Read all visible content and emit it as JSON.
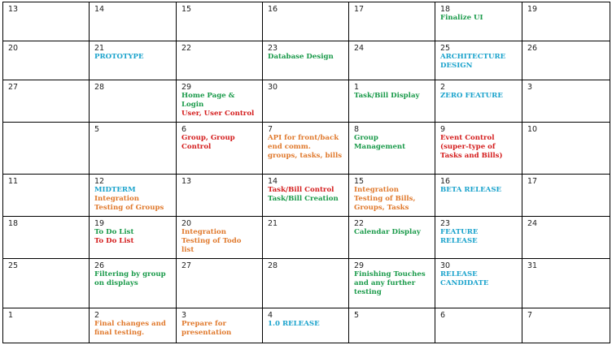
{
  "rows": [
    [
      {
        "day": "13",
        "events": []
      },
      {
        "day": "14",
        "events": []
      },
      {
        "day": "15",
        "events": []
      },
      {
        "day": "16",
        "events": []
      },
      {
        "day": "17",
        "events": []
      },
      {
        "day": "18",
        "events": [
          {
            "text": "Finalize UI",
            "color": "green"
          }
        ]
      },
      {
        "day": "19",
        "events": []
      }
    ],
    [
      {
        "day": "20",
        "events": []
      },
      {
        "day": "21",
        "events": [
          {
            "text": "PROTOTYPE",
            "color": "blue"
          }
        ]
      },
      {
        "day": "22",
        "events": []
      },
      {
        "day": "23",
        "events": [
          {
            "text": "Database Design",
            "color": "green"
          }
        ]
      },
      {
        "day": "24",
        "events": []
      },
      {
        "day": "25",
        "events": [
          {
            "text": "ARCHITECTURE\nDESIGN",
            "color": "blue"
          }
        ]
      },
      {
        "day": "26",
        "events": []
      }
    ],
    [
      {
        "day": "27",
        "events": []
      },
      {
        "day": "28",
        "events": []
      },
      {
        "day": "29",
        "events": [
          {
            "text": "Home Page &\nLogin",
            "color": "green"
          },
          {
            "text": "User, User Control",
            "color": "red"
          }
        ]
      },
      {
        "day": "30",
        "events": []
      },
      {
        "day": "1",
        "events": [
          {
            "text": "Task/Bill Display",
            "color": "green"
          }
        ]
      },
      {
        "day": "2",
        "events": [
          {
            "text": "ZERO FEATURE",
            "color": "blue"
          }
        ]
      },
      {
        "day": "3",
        "events": []
      }
    ],
    [
      {
        "day": "",
        "events": []
      },
      {
        "day": "5",
        "events": []
      },
      {
        "day": "6",
        "events": [
          {
            "text": "Group, Group\nControl",
            "color": "red"
          }
        ]
      },
      {
        "day": "7",
        "events": [
          {
            "text": "API for front/back\nend comm.\ngroups, tasks, bills",
            "color": "orange"
          }
        ]
      },
      {
        "day": "8",
        "events": [
          {
            "text": "Group\nManagement",
            "color": "green"
          }
        ]
      },
      {
        "day": "9",
        "events": [
          {
            "text": "Event Control\n(super-type of\nTasks and Bills)",
            "color": "red"
          }
        ]
      },
      {
        "day": "10",
        "events": []
      }
    ],
    [
      {
        "day": "11",
        "events": []
      },
      {
        "day": "12",
        "events": [
          {
            "text": "MIDTERM",
            "color": "blue"
          },
          {
            "text": "Integration\nTesting of Groups",
            "color": "orange"
          }
        ]
      },
      {
        "day": "13",
        "events": []
      },
      {
        "day": "14",
        "events": [
          {
            "text": "Task/Bill Control",
            "color": "red"
          },
          {
            "text": "Task/Bill Creation",
            "color": "green"
          }
        ]
      },
      {
        "day": "15",
        "events": [
          {
            "text": "Integration\nTesting of Bills,\nGroups, Tasks",
            "color": "orange"
          }
        ]
      },
      {
        "day": "16",
        "events": [
          {
            "text": "BETA RELEASE",
            "color": "blue"
          }
        ]
      },
      {
        "day": "17",
        "events": []
      }
    ],
    [
      {
        "day": "18",
        "events": []
      },
      {
        "day": "19",
        "events": [
          {
            "text": "To Do List",
            "color": "green"
          },
          {
            "text": "To Do List",
            "color": "red"
          }
        ]
      },
      {
        "day": "20",
        "events": [
          {
            "text": "Integration\nTesting of Todo\nlist",
            "color": "orange"
          }
        ]
      },
      {
        "day": "21",
        "events": []
      },
      {
        "day": "22",
        "events": [
          {
            "text": "Calendar Display",
            "color": "green"
          }
        ]
      },
      {
        "day": "23",
        "events": [
          {
            "text": "FEATURE\nRELEASE",
            "color": "blue"
          }
        ]
      },
      {
        "day": "24",
        "events": []
      }
    ],
    [
      {
        "day": "25",
        "events": []
      },
      {
        "day": "26",
        "events": [
          {
            "text": "Filtering by group\non displays",
            "color": "green"
          }
        ]
      },
      {
        "day": "27",
        "events": []
      },
      {
        "day": "28",
        "events": []
      },
      {
        "day": "29",
        "events": [
          {
            "text": "Finishing Touches\nand any further\ntesting",
            "color": "green"
          }
        ]
      },
      {
        "day": "30",
        "events": [
          {
            "text": "RELEASE\nCANDIDATE",
            "color": "blue"
          }
        ]
      },
      {
        "day": "31",
        "events": []
      }
    ],
    [
      {
        "day": "1",
        "events": []
      },
      {
        "day": "2",
        "events": [
          {
            "text": "Final changes and\nfinal testing.",
            "color": "orange"
          }
        ]
      },
      {
        "day": "3",
        "events": [
          {
            "text": "Prepare for\npresentation",
            "color": "orange"
          }
        ]
      },
      {
        "day": "4",
        "events": [
          {
            "text": "1.0 RELEASE",
            "color": "blue"
          }
        ]
      },
      {
        "day": "5",
        "events": []
      },
      {
        "day": "6",
        "events": []
      },
      {
        "day": "7",
        "events": []
      }
    ]
  ]
}
